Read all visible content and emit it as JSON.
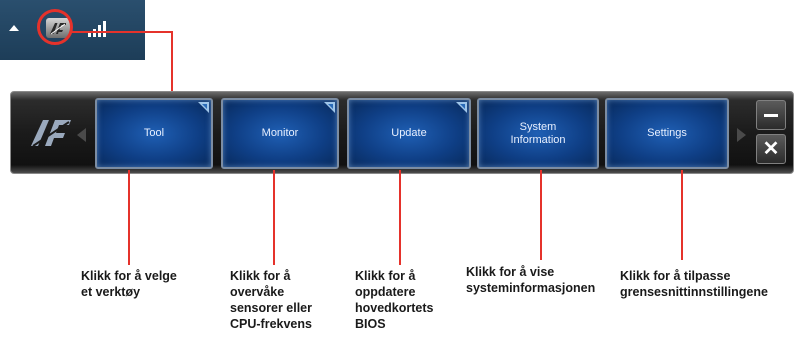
{
  "tray": {
    "icons": [
      "tray-expand-arrow",
      "ai-suite-icon",
      "signal-icon"
    ]
  },
  "toolbar": {
    "buttons": [
      {
        "label": "Tool",
        "has_corner_marker": true
      },
      {
        "label": "Monitor",
        "has_corner_marker": true
      },
      {
        "label": "Update",
        "has_corner_marker": true
      },
      {
        "label": "System\nInformation",
        "has_corner_marker": false
      },
      {
        "label": "Settings",
        "has_corner_marker": false
      }
    ],
    "window_controls": [
      "minimize",
      "close"
    ],
    "close_glyph": "✕"
  },
  "captions": [
    {
      "text": "Klikk for å velge\net verktøy"
    },
    {
      "text": "Klikk for å\novervåke\nsensorer eller\nCPU-frekvens"
    },
    {
      "text": "Klikk for å\noppdatere\nhovedkortets\nBIOS"
    },
    {
      "text": "Klikk for å vise\nsysteminformasjonen"
    },
    {
      "text": "Klikk for å tilpasse\ngrensesnittinnstillingene"
    }
  ],
  "colors": {
    "accent_red": "#e5322b",
    "button_blue": "#0f3f86",
    "bar_dark": "#1b1b1b"
  }
}
